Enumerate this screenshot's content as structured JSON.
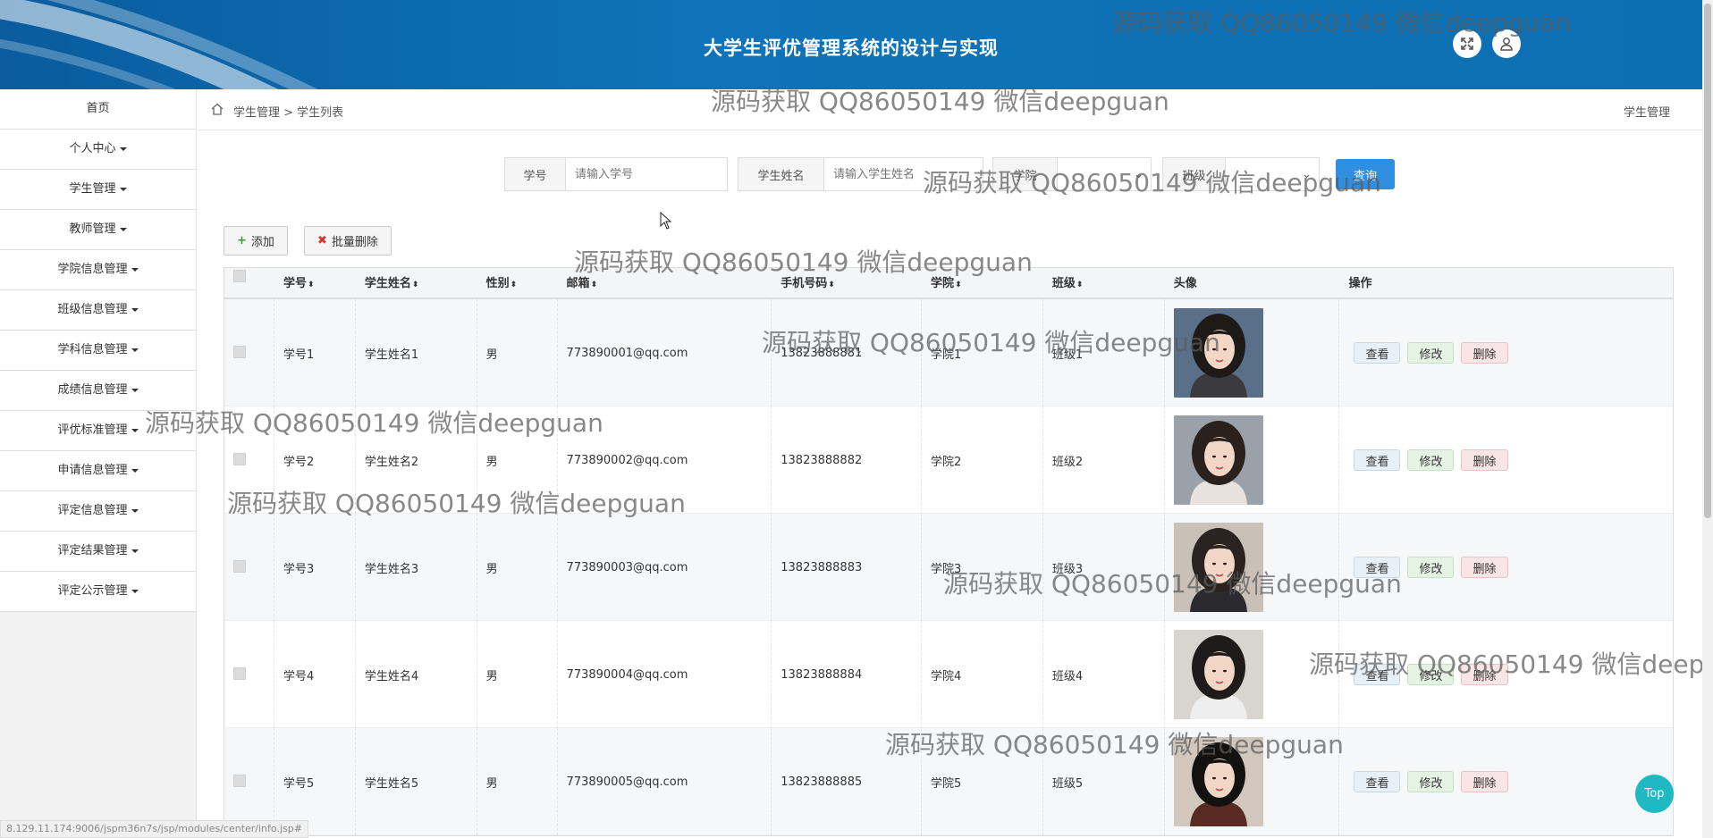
{
  "header": {
    "title": "大学生评优管理系统的设计与实现",
    "fullscreen_icon": "expand-icon",
    "user_icon": "user-icon"
  },
  "sidebar": {
    "items": [
      {
        "label": "首页",
        "has_caret": false
      },
      {
        "label": "个人中心",
        "has_caret": true
      },
      {
        "label": "学生管理",
        "has_caret": true
      },
      {
        "label": "教师管理",
        "has_caret": true
      },
      {
        "label": "学院信息管理",
        "has_caret": true
      },
      {
        "label": "班级信息管理",
        "has_caret": true
      },
      {
        "label": "学科信息管理",
        "has_caret": true
      },
      {
        "label": "成绩信息管理",
        "has_caret": true
      },
      {
        "label": "评优标准管理",
        "has_caret": true
      },
      {
        "label": "申请信息管理",
        "has_caret": true
      },
      {
        "label": "评定信息管理",
        "has_caret": true
      },
      {
        "label": "评定结果管理",
        "has_caret": true
      },
      {
        "label": "评定公示管理",
        "has_caret": true
      }
    ]
  },
  "breadcrumb": {
    "path": "学生管理 > 学生列表",
    "right": "学生管理"
  },
  "search": {
    "id_label": "学号",
    "id_placeholder": "请输入学号",
    "name_label": "学生姓名",
    "name_placeholder": "请输入学生姓名",
    "college_label": "学院",
    "class_label": "班级",
    "query_label": "查询"
  },
  "actions": {
    "add_label": "添加",
    "batch_delete_label": "批量删除"
  },
  "table": {
    "headers": [
      "学号",
      "学生姓名",
      "性别",
      "邮箱",
      "手机号码",
      "学院",
      "班级",
      "头像",
      "操作"
    ],
    "rows": [
      {
        "id": "学号1",
        "name": "学生姓名1",
        "gender": "男",
        "email": "773890001@qq.com",
        "phone": "13823888881",
        "college": "学院1",
        "class": "班级1"
      },
      {
        "id": "学号2",
        "name": "学生姓名2",
        "gender": "男",
        "email": "773890002@qq.com",
        "phone": "13823888882",
        "college": "学院2",
        "class": "班级2"
      },
      {
        "id": "学号3",
        "name": "学生姓名3",
        "gender": "男",
        "email": "773890003@qq.com",
        "phone": "13823888883",
        "college": "学院3",
        "class": "班级3"
      },
      {
        "id": "学号4",
        "name": "学生姓名4",
        "gender": "男",
        "email": "773890004@qq.com",
        "phone": "13823888884",
        "college": "学院4",
        "class": "班级4"
      },
      {
        "id": "学号5",
        "name": "学生姓名5",
        "gender": "男",
        "email": "773890005@qq.com",
        "phone": "13823888885",
        "college": "学院5",
        "class": "班级5"
      }
    ],
    "ops": {
      "view": "查看",
      "edit": "修改",
      "delete": "删除"
    }
  },
  "top_button": "Top",
  "status_url": "8.129.11.174:9006/jspm36n7s/jsp/modules/center/info.jsp#",
  "watermark": "源码获取 QQ86050149 微信deepguan",
  "colors": {
    "header": "#0e73b8",
    "query_button": "#2f8ee0",
    "top_button": "#1fb9c4"
  }
}
